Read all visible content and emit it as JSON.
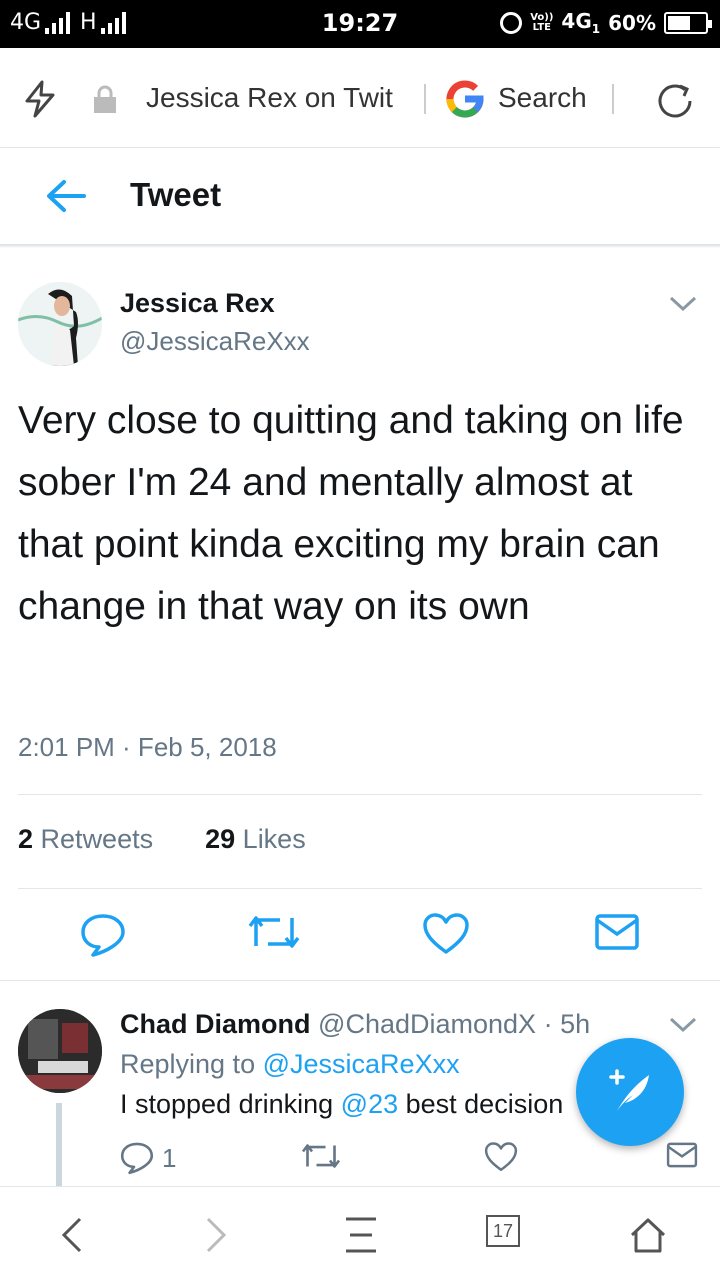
{
  "status_bar": {
    "network_left": "4G",
    "network_h": "H",
    "time": "19:27",
    "volte_top": "Vo))",
    "volte_bottom": "LTE",
    "network_right": "4G",
    "network_sub": "1",
    "battery": "60%"
  },
  "browser": {
    "page_title": "Jessica Rex on Twit",
    "search_label": "Search"
  },
  "header": {
    "title": "Tweet"
  },
  "tweet": {
    "author_name": "Jessica Rex",
    "author_handle": "@JessicaReXxx",
    "text": "Very close to quitting and taking on life sober I'm 24 and mentally almost at that point kinda exciting my brain can change in that way on its own",
    "timestamp": "2:01 PM · Feb 5, 2018",
    "retweets_count": "2",
    "retweets_label": "Retweets",
    "likes_count": "29",
    "likes_label": "Likes"
  },
  "reply": {
    "author_name": "Chad Diamond",
    "author_handle": "@ChadDiamondX",
    "separator": "·",
    "time_ago": "5h",
    "replying_prefix": "Replying to",
    "replying_to": "@JessicaReXxx",
    "text_before": "I stopped drinking",
    "mention": "@23",
    "text_after": "best decision",
    "reply_count": "1"
  },
  "bottom_nav": {
    "tab_count": "17"
  },
  "colors": {
    "accent": "#1da1f2",
    "muted": "#657786",
    "text": "#14171a"
  }
}
